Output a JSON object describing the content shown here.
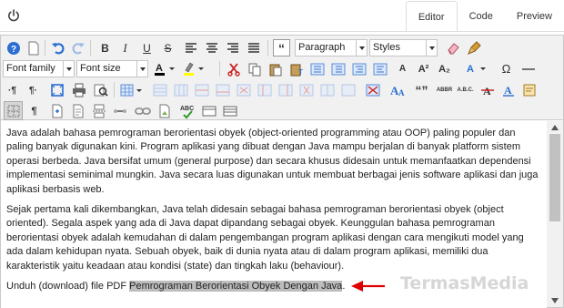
{
  "tabs": [
    {
      "label": "Editor",
      "active": true
    },
    {
      "label": "Code",
      "active": false
    },
    {
      "label": "Preview",
      "active": false
    }
  ],
  "toolbar": {
    "format_select": "Paragraph",
    "styles_select": "Styles",
    "font_family_select": "Font family",
    "font_size_select": "Font size",
    "bold": "B",
    "italic": "I",
    "underline": "U",
    "strikethrough": "S",
    "blockquote": "“",
    "superscript": "A²",
    "subscript": "A₂",
    "special_char": "Ω",
    "paragraph": "¶"
  },
  "colors": {
    "text_color_swatch": "#000000",
    "highlight_swatch": "#ffff00",
    "arrow": "#dd0000",
    "highlight_bg": "#bdbdbd"
  },
  "content": {
    "paragraph_1": "Java adalah bahasa pemrograman berorientasi obyek (object-oriented programming atau OOP) paling populer dan paling banyak digunakan kini. Program aplikasi yang dibuat dengan Java mampu berjalan di banyak platform sistem operasi berbeda. Java bersifat umum (general purpose) dan secara khusus didesain untuk memanfaatkan dependensi implementasi seminimal mungkin. Java secara luas digunakan untuk membuat berbagai jenis software aplikasi dan juga aplikasi berbasis web.",
    "paragraph_2": "Sejak pertama kali dikembangkan, Java telah didesain sebagai bahasa pemrograman berorientasi obyek (object oriented). Segala aspek yang ada di Java dapat dipandang sebagai obyek. Keunggulan bahasa pemrograman berorientasi obyek adalah kemudahan di dalam pengembangan program aplikasi dengan cara mengikuti model yang ada dalam kehidupan nyata. Sebuah obyek, baik di dunia nyata atau di dalam program aplikasi, memiliki dua karakteristik yaitu keadaan atau kondisi (state) dan tingkah laku (behaviour).",
    "paragraph_3_prefix": "Unduh (download) file PDF ",
    "paragraph_3_selected": "Pemrograman Berorientasi Obyek Dengan Java",
    "paragraph_3_suffix": "."
  },
  "watermark": "TermasMedia"
}
